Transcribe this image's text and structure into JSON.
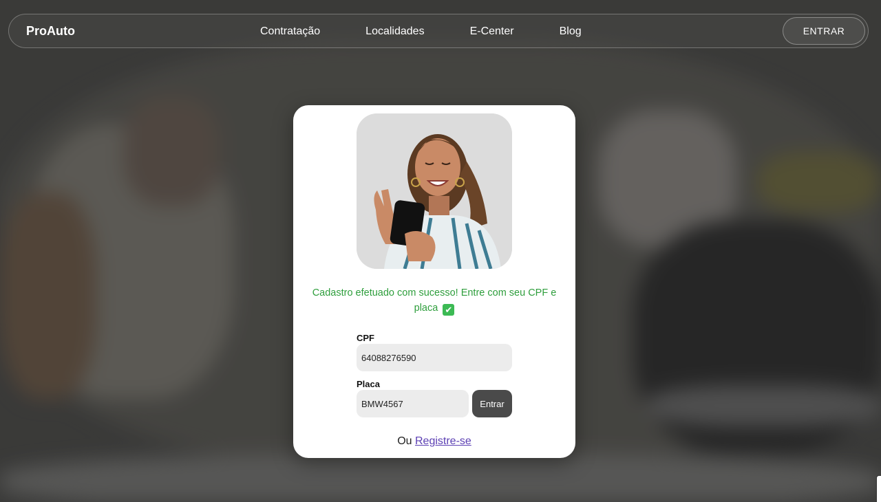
{
  "nav": {
    "brand": "ProAuto",
    "links": [
      "Contratação",
      "Localidades",
      "E-Center",
      "Blog"
    ],
    "login_label": "ENTRAR"
  },
  "card": {
    "photo_icon": "woman-with-phone-photo",
    "message": "Cadastro efetuado com sucesso! Entre com seu CPF e placa",
    "message_icon": "check-mark-icon",
    "cpf_label": "CPF",
    "cpf_value": "64088276590",
    "placa_label": "Placa",
    "placa_value": "BMW4567",
    "enter_label": "Entrar",
    "or_text": "Ou",
    "register_link": "Registre-se"
  },
  "colors": {
    "success": "#2e9e3c",
    "link": "#5b3fb3",
    "button": "#4a4a4a"
  }
}
